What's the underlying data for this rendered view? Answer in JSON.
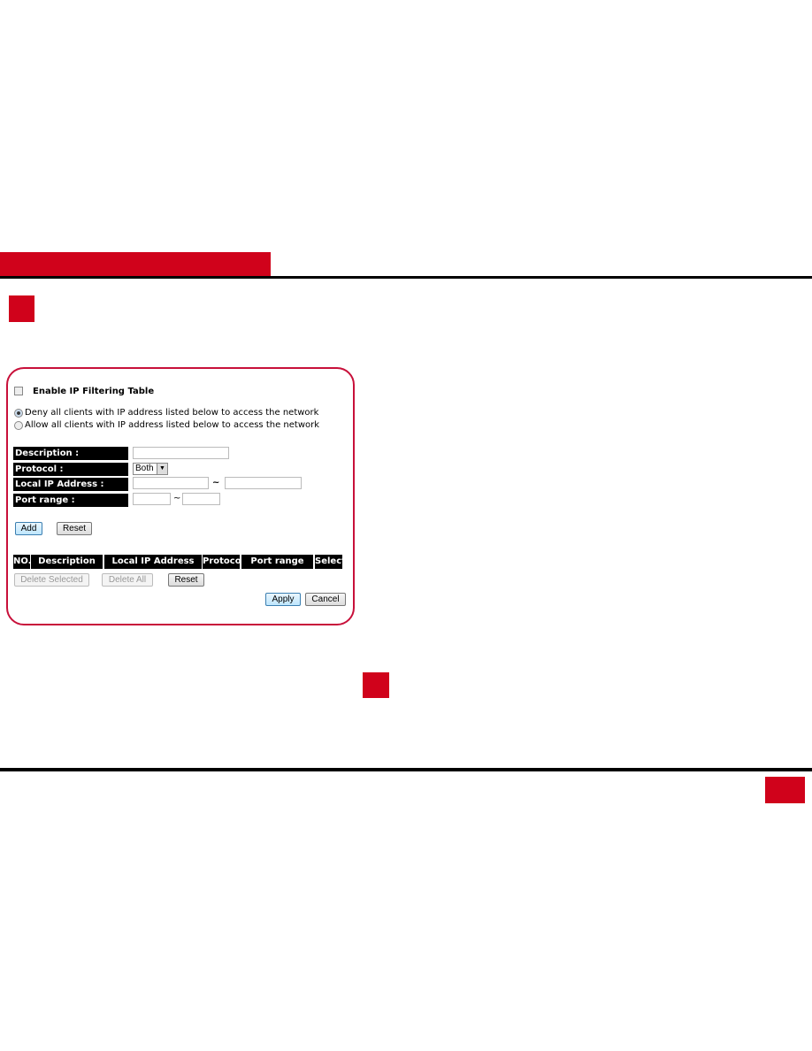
{
  "form": {
    "enable_label": "Enable IP Filtering Table",
    "deny_label": "Deny all clients with IP address listed below to access the network",
    "allow_label": "Allow all clients with IP address listed below to access the network",
    "description_label": "Description :",
    "protocol_label": "Protocol :",
    "protocol_value": "Both",
    "local_ip_label": "Local IP Address :",
    "port_range_label": "Port range :",
    "tilde": "~",
    "add": "Add",
    "reset": "Reset"
  },
  "table": {
    "headers": [
      "NO.",
      "Description",
      "Local IP Address",
      "Protocol",
      "Port range",
      "Select"
    ]
  },
  "actions": {
    "delete_selected": "Delete Selected",
    "delete_all": "Delete All",
    "reset": "Reset",
    "apply": "Apply",
    "cancel": "Cancel"
  },
  "colors": {
    "accent": "#d0021b"
  }
}
